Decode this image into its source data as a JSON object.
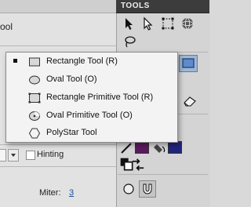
{
  "left_panel": {
    "tool_title_partial": "ool",
    "hinting_label": "Hinting",
    "miter_label": "Miter:",
    "miter_value": "3"
  },
  "tools_panel": {
    "title": "TOOLS",
    "stroke_color": "#5a1a5e",
    "fill_color": "#22247a"
  },
  "shape_menu": {
    "items": [
      {
        "label": "Rectangle Tool (R)",
        "icon": "rectangle-icon",
        "checked": true
      },
      {
        "label": "Oval Tool (O)",
        "icon": "oval-icon",
        "checked": false
      },
      {
        "label": "Rectangle Primitive Tool (R)",
        "icon": "rectangle-primitive-icon",
        "checked": false
      },
      {
        "label": "Oval Primitive Tool (O)",
        "icon": "oval-primitive-icon",
        "checked": false
      },
      {
        "label": "PolyStar Tool",
        "icon": "polystar-icon",
        "checked": false
      }
    ]
  }
}
